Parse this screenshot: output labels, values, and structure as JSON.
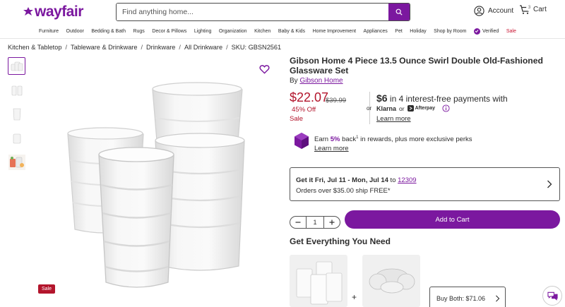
{
  "header": {
    "logo": "wayfair",
    "search_placeholder": "Find anything home...",
    "account_label": "Account",
    "cart_label": "Cart",
    "cart_count": "3"
  },
  "nav": {
    "items": [
      "Furniture",
      "Outdoor",
      "Bedding & Bath",
      "Rugs",
      "Decor & Pillows",
      "Lighting",
      "Organization",
      "Kitchen",
      "Baby & Kids",
      "Home Improvement",
      "Appliances",
      "Pet",
      "Holiday",
      "Shop by Room",
      "Verified",
      "Sale"
    ]
  },
  "breadcrumb": {
    "items": [
      "Kitchen & Tabletop",
      "Tableware & Drinkware",
      "Drinkware",
      "All Drinkware"
    ],
    "sku": "SKU: GBSN2561",
    "separator": "/"
  },
  "product": {
    "title": "Gibson Home 4 Piece 13.5 Ounce Swirl Double Old-Fashioned Glassware Set",
    "by": "By",
    "brand": "Gibson Home",
    "price": "$22.07",
    "old_price": "$39.99",
    "discount": "45% Off",
    "sale_label": "Sale",
    "image_sale_tag": "Sale"
  },
  "financing": {
    "or": "or",
    "amount": "$6",
    "rest": " in 4 interest-free payments with",
    "klarna": "Klarna",
    "or2": "or",
    "afterpay": "Afterpay",
    "learn_more": "Learn more"
  },
  "rewards": {
    "prefix": "Earn ",
    "percent": "5%",
    "text": " back",
    "sup": "1",
    "rest": " in rewards, plus more exclusive perks",
    "learn_more": "Learn more"
  },
  "delivery": {
    "line1_bold": "Get it Fri, Jul 11 - Mon, Jul 14",
    "line1_to": " to ",
    "zip": "12309",
    "line2": "Orders over $35.00 ship FREE*"
  },
  "purchase": {
    "qty": "1",
    "add_to_cart": "Add to Cart"
  },
  "bundle": {
    "heading": "Get Everything You Need",
    "plus": "+",
    "buy_both": "Buy Both: $71.06"
  },
  "colors": {
    "brand": "#7b189f",
    "sale": "#b3152c"
  }
}
